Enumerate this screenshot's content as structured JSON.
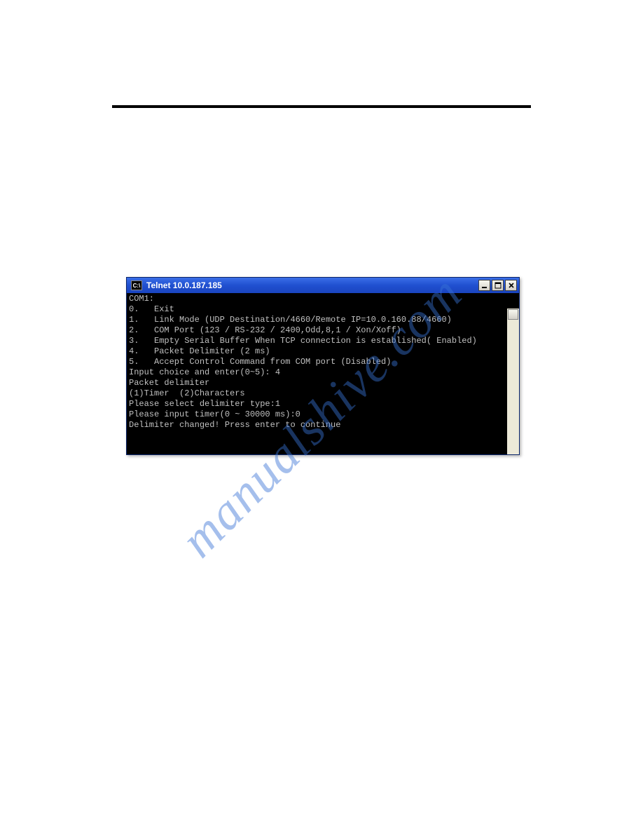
{
  "watermark": "manualshive.com",
  "window": {
    "title": "Telnet 10.0.187.185",
    "icon_label": "C:\\",
    "controls": {
      "minimize": "_",
      "maximize": "❐",
      "close": "✕"
    }
  },
  "terminal": {
    "lines": [
      "COM1:",
      "0.   Exit",
      "1.   Link Mode (UDP Destination/4660/Remote IP=10.0.160.88/4660)",
      "2.   COM Port (123 / RS-232 / 2400,Odd,8,1 / Xon/Xoff)",
      "3.   Empty Serial Buffer When TCP connection is established( Enabled)",
      "4.   Packet Delimiter (2 ms)",
      "5.   Accept Control Command from COM port (Disabled)",
      "",
      "Input choice and enter(0~5): 4",
      "",
      "Packet delimiter",
      "(1)Timer  (2)Characters",
      "Please select delimiter type:1",
      "Please input timer(0 ~ 30000 ms):0",
      "Delimiter changed! Press enter to continue"
    ]
  }
}
